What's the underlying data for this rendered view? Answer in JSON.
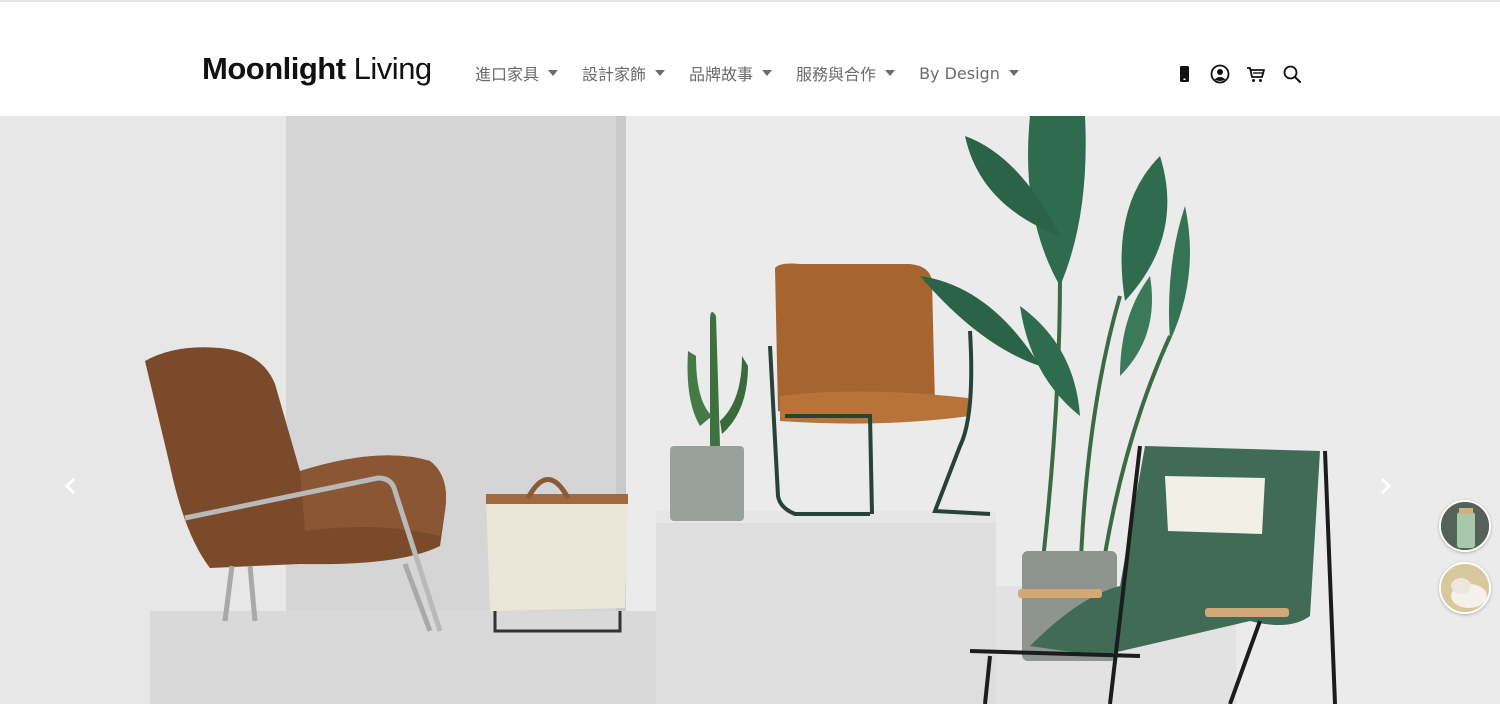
{
  "brand": {
    "logo_bold": "Moonlight",
    "logo_light": " Living"
  },
  "nav": {
    "items": [
      {
        "label": "進口家具"
      },
      {
        "label": "設計家飾"
      },
      {
        "label": "品牌故事"
      },
      {
        "label": "服務與合作"
      },
      {
        "label": "By Design"
      }
    ]
  },
  "header_icons": [
    "mobile-phone-icon",
    "user-account-icon",
    "shopping-cart-icon",
    "search-icon"
  ],
  "carousel": {
    "prev_icon": "chevron-left-icon",
    "next_icon": "chevron-right-icon",
    "thumbnails": 2
  },
  "colors": {
    "nav_text": "#6b6b6b",
    "logo_text": "#111111",
    "hero_wall": "#e9e9e9",
    "plant_green": "#2f6b4f",
    "leather_brown": "#a8642f",
    "fabric_brown": "#7a4a2a",
    "sling_green": "#3f6b57"
  }
}
